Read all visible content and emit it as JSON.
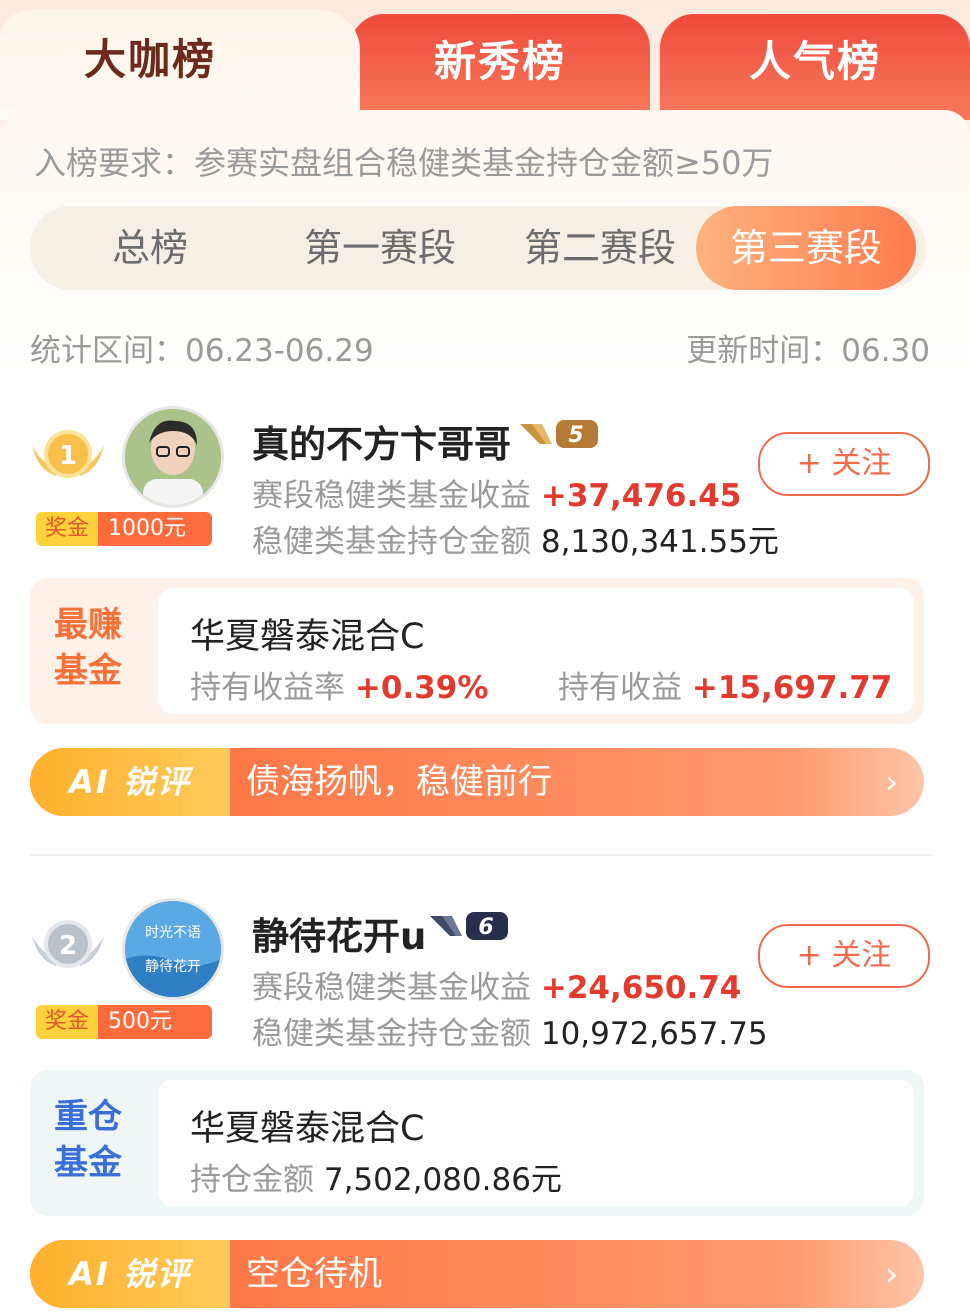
{
  "tabs": [
    {
      "label": "大咖榜",
      "active": true
    },
    {
      "label": "新秀榜",
      "active": false
    },
    {
      "label": "人气榜",
      "active": false
    }
  ],
  "requirement": "入榜要求：参赛实盘组合稳健类基金持仓金额≥50万",
  "stages": [
    {
      "label": "总榜",
      "active": false
    },
    {
      "label": "第一赛段",
      "active": false
    },
    {
      "label": "第二赛段",
      "active": false
    },
    {
      "label": "第三赛段",
      "active": true
    }
  ],
  "stat_range": "统计区间：06.23-06.29",
  "update_time": "更新时间：06.30",
  "follow_label": "+ 关注",
  "ai_label": "AI 锐评",
  "entries": [
    {
      "rank": "1",
      "prize_label": "奖金",
      "prize_value": "1000元",
      "name": "真的不方卞哥哥",
      "level": "5",
      "profit_label": "赛段稳健类基金收益",
      "profit_value": "+37,476.45",
      "holding_label": "稳健类基金持仓金额",
      "holding_value": "8,130,341.55元",
      "fund_tag_line1": "最赚",
      "fund_tag_line2": "基金",
      "fund_name": "华夏磐泰混合C",
      "fund_rate_label": "持有收益率",
      "fund_rate_value": "+0.39%",
      "fund_profit_label": "持有收益",
      "fund_profit_value": "+15,697.77",
      "ai_comment": "债海扬帆，稳健前行"
    },
    {
      "rank": "2",
      "prize_label": "奖金",
      "prize_value": "500元",
      "name": "静待花开u",
      "level": "6",
      "avatar_text_1": "时光不语",
      "avatar_text_2": "静待花开",
      "profit_label": "赛段稳健类基金收益",
      "profit_value": "+24,650.74",
      "holding_label": "稳健类基金持仓金额",
      "holding_value": "10,972,657.75",
      "fund_tag_line1": "重仓",
      "fund_tag_line2": "基金",
      "fund_name": "华夏磐泰混合C",
      "fund_amount_label": "持仓金额",
      "fund_amount_value": "7,502,080.86元",
      "ai_comment": "空仓待机"
    }
  ],
  "colors": {
    "accent_red": "#e23a2e",
    "tab_red": "#f04a3c",
    "orange": "#ff7b4e",
    "gold": "#ffd23b",
    "fund_tag_blue": "#3a6fd8"
  },
  "icons": {
    "medal_1": "gold-medal-icon",
    "medal_2": "silver-medal-icon",
    "level_badge": "v-level-badge-icon",
    "arrow": "chevron-right-icon"
  }
}
